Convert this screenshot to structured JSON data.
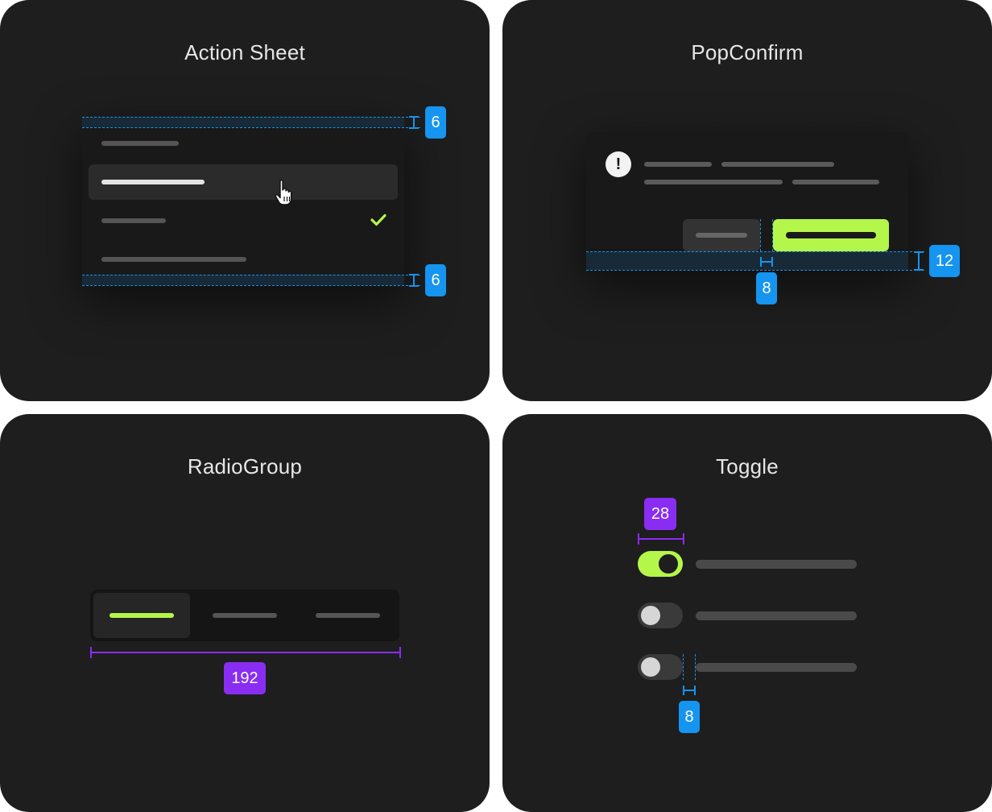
{
  "panels": {
    "action_sheet": {
      "title": "Action Sheet",
      "spacing_top": "6",
      "spacing_bottom": "6"
    },
    "pop_confirm": {
      "title": "PopConfirm",
      "button_gap": "8",
      "bottom_padding": "12",
      "alert_glyph": "!"
    },
    "radio_group": {
      "title": "RadioGroup",
      "width": "192"
    },
    "toggle": {
      "title": "Toggle",
      "toggle_width": "28",
      "label_gap": "8",
      "states": [
        "on",
        "off",
        "off"
      ]
    }
  },
  "colors": {
    "panel_bg": "#1e1e1e",
    "accent_green": "#b5f64a",
    "measure_blue": "#1594f0",
    "measure_purple": "#8a2df2"
  },
  "icons": [
    "hand-cursor-icon",
    "checkmark-icon",
    "alert-icon"
  ]
}
